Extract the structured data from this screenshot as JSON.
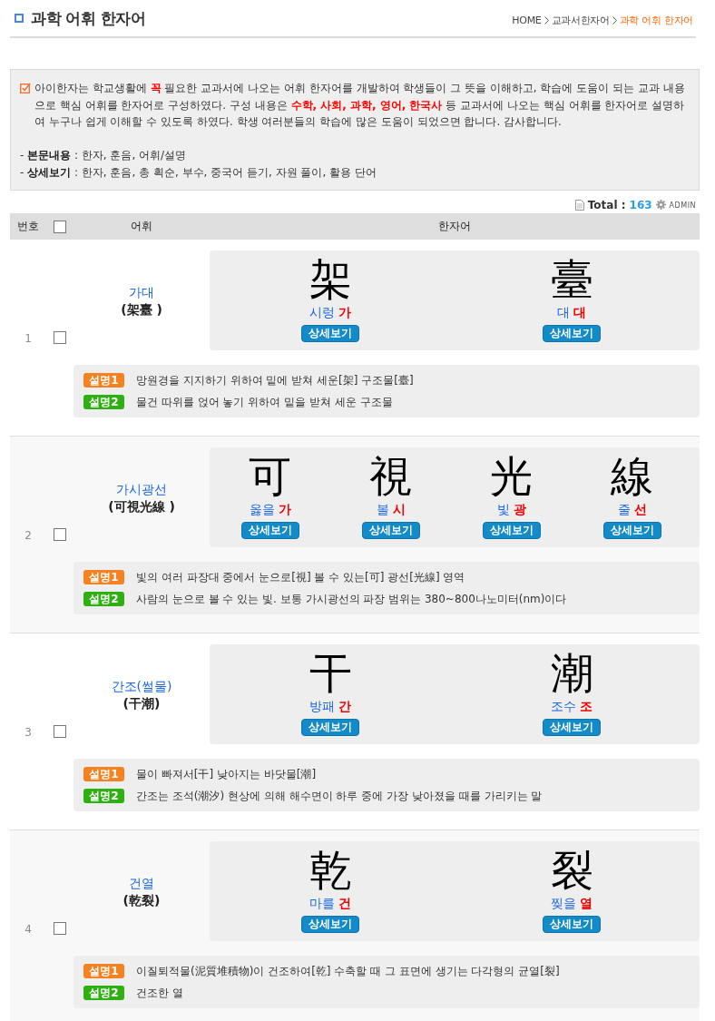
{
  "header": {
    "title": "과학 어휘 한자어",
    "breadcrumb": [
      {
        "label": "HOME",
        "selected": false
      },
      {
        "label": "교과서한자어",
        "selected": false
      },
      {
        "label": "과학 어휘 한자어",
        "selected": true
      }
    ]
  },
  "intro": {
    "paragraph": "아이한자는 학교생활에 **꼭** 필요한 교과서에 나오는 어휘 한자어를 개발하여 학생들이 그 뜻을 이해하고, 학습에 도움이 되는 교과 내용으로 핵심 어휘를 한자어로 구성하였다. 구성 내용은 **수학, 사회, 과학, 영어, 한국사** 등 교과서에 나오는 핵심 어휘를 한자어로 설명하여 누구나 쉽게 이해할 수 있도록 하였다. 학생 여러분들의 학습에 많은 도움이 되었으면 합니다. 감사합니다.",
    "details": [
      "- **본문내용** : 한자, 훈음, 어휘/설명",
      "- **상세보기** : 한자, 훈음, 총 획순, 부수, 중국어 듣기, 자원 풀이, 활용 단어"
    ]
  },
  "summary": {
    "total_label": "Total :",
    "total_count": "163",
    "admin_link": "ADMIN"
  },
  "table": {
    "columns": [
      "번호",
      "어휘",
      "한자어"
    ],
    "all_checked": false,
    "rows": [
      {
        "number": "1",
        "checked": false,
        "word": "가대",
        "hanja_word": "(架臺 )",
        "characters": [
          {
            "hanja": "架",
            "meaning": "시렁",
            "sound": "가",
            "button": "상세보기"
          },
          {
            "hanja": "臺",
            "meaning": "대",
            "sound": "대",
            "button": "상세보기"
          }
        ],
        "explanations": [
          {
            "label": "설명1",
            "color": "#f68120",
            "text": "망원경을 지지하기 위하여 밑에 받쳐 세운[架] 구조물[臺]"
          },
          {
            "label": "설명2",
            "color": "#2eb012",
            "text": "물건 따위를 얹어 놓기 위하여 밑을 받쳐 세운 구조물"
          }
        ]
      },
      {
        "number": "2",
        "checked": false,
        "word": "가시광선",
        "hanja_word": "(可視光線 )",
        "characters": [
          {
            "hanja": "可",
            "meaning": "옳을",
            "sound": "가",
            "button": "상세보기"
          },
          {
            "hanja": "視",
            "meaning": "볼",
            "sound": "시",
            "button": "상세보기"
          },
          {
            "hanja": "光",
            "meaning": "빛",
            "sound": "광",
            "button": "상세보기"
          },
          {
            "hanja": "線",
            "meaning": "줄",
            "sound": "선",
            "button": "상세보기"
          }
        ],
        "explanations": [
          {
            "label": "설명1",
            "color": "#f68120",
            "text": "빛의 여러 파장대 중에서 눈으로[視] 볼 수 있는[可] 광선[光線] 영역"
          },
          {
            "label": "설명2",
            "color": "#2eb012",
            "text": "사람의 눈으로 볼 수 있는 빛. 보통 가시광선의 파장 범위는 380~800나노미터(nm)이다"
          }
        ]
      },
      {
        "number": "3",
        "checked": false,
        "word": "간조(썰물)",
        "hanja_word": "(干潮)",
        "characters": [
          {
            "hanja": "干",
            "meaning": "방패",
            "sound": "간",
            "button": "상세보기"
          },
          {
            "hanja": "潮",
            "meaning": "조수",
            "sound": "조",
            "button": "상세보기"
          }
        ],
        "explanations": [
          {
            "label": "설명1",
            "color": "#f68120",
            "text": "물이 빠져서[干] 낮아지는 바닷물[潮]"
          },
          {
            "label": "설명2",
            "color": "#2eb012",
            "text": "간조는 조석(潮汐) 현상에 의해 해수면이 하루 중에 가장 낮아졌을 때를 가리키는 말"
          }
        ]
      },
      {
        "number": "4",
        "checked": false,
        "word": "건열",
        "hanja_word": "(乾裂)",
        "characters": [
          {
            "hanja": "乾",
            "meaning": "마를",
            "sound": "건",
            "button": "상세보기"
          },
          {
            "hanja": "裂",
            "meaning": "찢을",
            "sound": "열",
            "button": "상세보기"
          }
        ],
        "explanations": [
          {
            "label": "설명1",
            "color": "#f68120",
            "text": "이질퇴적물(泥質堆積物)이 건조하여[乾] 수축할 때 그 표면에 생기는 다각형의 균열[裂]"
          },
          {
            "label": "설명2",
            "color": "#2eb012",
            "text": "건조한 열"
          }
        ]
      }
    ]
  }
}
